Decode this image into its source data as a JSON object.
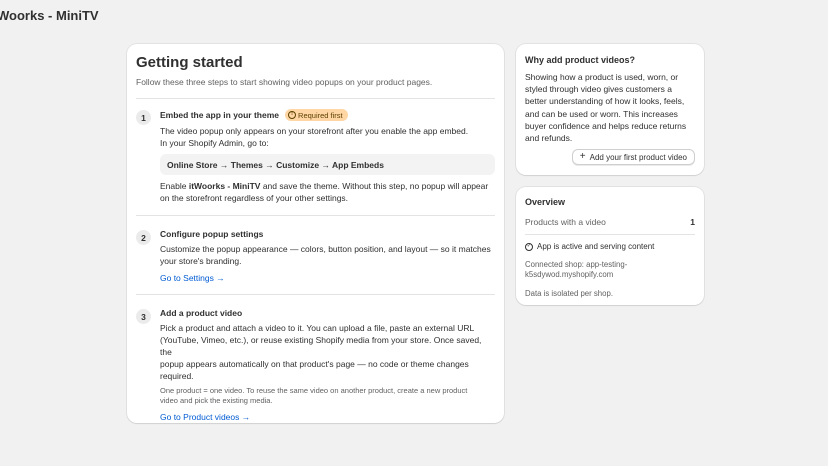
{
  "app": {
    "title": "Woorks - MiniTV"
  },
  "getting_started": {
    "title": "Getting started",
    "subtitle": "Follow these three steps to start showing video popups on your product pages.",
    "steps": [
      {
        "number": "1",
        "title": "Embed the app in your theme",
        "badge": "Required first",
        "text1": "The video popup only appears on your storefront after you enable the app embed.",
        "text2": "In your Shopify Admin, go to:",
        "path": "Online Store → Themes → Customize → App Embeds",
        "enable_prefix": "Enable ",
        "enable_app": "itWoorks - MiniTV",
        "enable_line1_suffix": " and save the theme. Without this step, no popup will appear",
        "enable_line2": "on the storefront regardless of your other settings."
      },
      {
        "number": "2",
        "title": "Configure popup settings",
        "text_line1": "Customize the popup appearance — colors, button position, and layout — so it matches",
        "text_line2": "your store's branding.",
        "link": "Go to Settings →"
      },
      {
        "number": "3",
        "title": "Add a product video",
        "text_lines": [
          "Pick a product and attach a video to it. You can upload a file, paste an external URL",
          "(YouTube, Vimeo, etc.), or reuse existing Shopify media from your store. Once saved, the",
          "popup appears automatically on that product's page — no code or theme changes",
          "required."
        ],
        "note_lines": [
          "One product = one video. To reuse the same video on another product, create a new product",
          "video and pick the existing media."
        ],
        "link": "Go to Product videos →"
      }
    ]
  },
  "why": {
    "title": "Why add product videos?",
    "text_lines": [
      "Showing how a product is used, worn, or",
      "styled through video gives customers a",
      "better understanding of how it looks, feels,",
      "and can be used or worn. This increases",
      "buyer confidence and helps reduce returns",
      "and refunds."
    ],
    "button": "Add your first product video"
  },
  "overview": {
    "title": "Overview",
    "products_label": "Products with a video",
    "products_count": "1",
    "status": "App is active and serving content",
    "shop_line1": "Connected shop: app-testing-",
    "shop_line2": "k5sdywod.myshopify.com",
    "isolation": "Data is isolated per shop."
  }
}
